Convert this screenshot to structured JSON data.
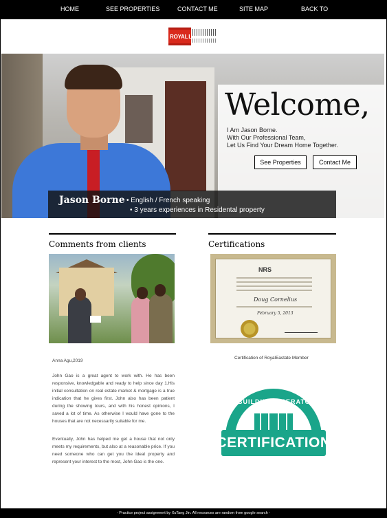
{
  "nav": {
    "items": [
      "HOME",
      "SEE PROPERTIES",
      "CONTACT ME",
      "SITE MAP",
      "BACK TO"
    ]
  },
  "logo": {
    "text_royal": "ROYAL",
    "text_lepage": "LEPAGE"
  },
  "hero": {
    "welcome": "Welcome,",
    "lines": [
      "I Am Jason Borne.",
      "With Our Professional Team,",
      "Let Us Find Your Dream Home Together."
    ],
    "see_properties": "See Properties",
    "contact_me": "Contact Me",
    "name": "Jason Borne",
    "facts": [
      "• English / French speaking",
      "• 3 years experiences in Residental property"
    ]
  },
  "comments": {
    "title": "Comments from clients",
    "meta": "Anna Agu,2019",
    "paragraphs": [
      "John Gao is a great agent to work with. He has been responsive, knowledgable and ready to help since day 1.His initial consultation on real estate market & mortgage is a true indication that he gives first. John also has been patient during the showing tours, and with his honest opinions, I saved a lot of time. As otherwise I would have gone to the houses that are not necessarily suitable for me.",
      "Eventually, John has helped me get a house that not only meets my requirements, but also at a reasonable price. If you need someone who can get you the ideal property and represent your interest to the most, John Gao is the one."
    ]
  },
  "certifications": {
    "title": "Certifications",
    "cert_org": "NRS",
    "cert_person": "Doug Cornelius",
    "cert_date": "February 5, 2013",
    "caption": "Certification of RoyalEastate Member",
    "badge_top": "BUILDING OPERATOR",
    "badge_bottom": "CERTIFICATION"
  },
  "footer": {
    "text": "- Practice project assignment by XuTang Jin. All resources are random from google search -"
  },
  "colors": {
    "nav_bg": "#000000",
    "brand_red": "#d9291c",
    "badge_green": "#1aa58a"
  }
}
